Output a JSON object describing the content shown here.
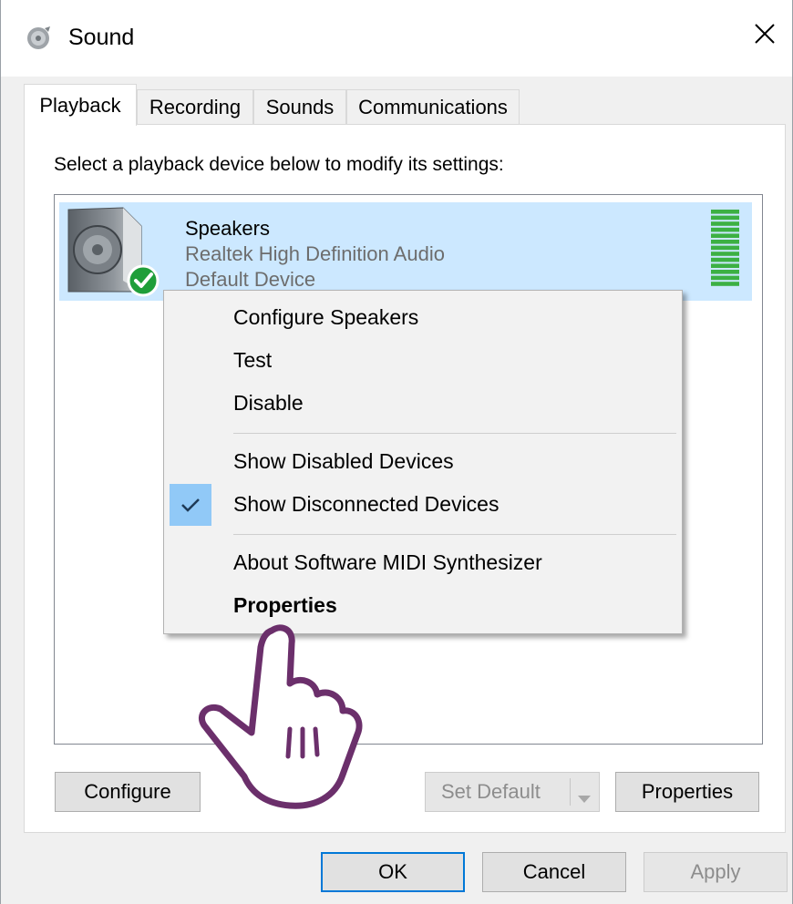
{
  "window": {
    "title": "Sound",
    "icon": "speaker-sound-icon",
    "close_icon": "close-icon"
  },
  "tabs": [
    {
      "label": "Playback",
      "active": true
    },
    {
      "label": "Recording",
      "active": false
    },
    {
      "label": "Sounds",
      "active": false
    },
    {
      "label": "Communications",
      "active": false
    }
  ],
  "playback": {
    "instruction": "Select a playback device below to modify its settings:",
    "device": {
      "name": "Speakers",
      "driver": "Realtek High Definition Audio",
      "status": "Default Device",
      "icon": "speaker-icon",
      "badge_icon": "default-check-icon"
    }
  },
  "context_menu": {
    "items": [
      {
        "label": "Configure Speakers",
        "checked": false,
        "bold": false
      },
      {
        "label": "Test",
        "checked": false,
        "bold": false
      },
      {
        "label": "Disable",
        "checked": false,
        "bold": false
      },
      {
        "label": "Show Disabled Devices",
        "checked": false,
        "bold": false
      },
      {
        "label": "Show Disconnected Devices",
        "checked": true,
        "bold": false
      },
      {
        "label": "About Software MIDI Synthesizer",
        "checked": false,
        "bold": false
      },
      {
        "label": "Properties",
        "checked": false,
        "bold": true
      }
    ]
  },
  "panel_buttons": {
    "configure": "Configure",
    "set_default": "Set Default",
    "properties": "Properties"
  },
  "dialog_buttons": {
    "ok": "OK",
    "cancel": "Cancel",
    "apply": "Apply"
  },
  "colors": {
    "selection": "#cce8ff",
    "accent": "#0078d7",
    "check_highlight": "#91c9f7",
    "meter_green": "#3cb043",
    "hand_outline": "#6b2f6b"
  }
}
